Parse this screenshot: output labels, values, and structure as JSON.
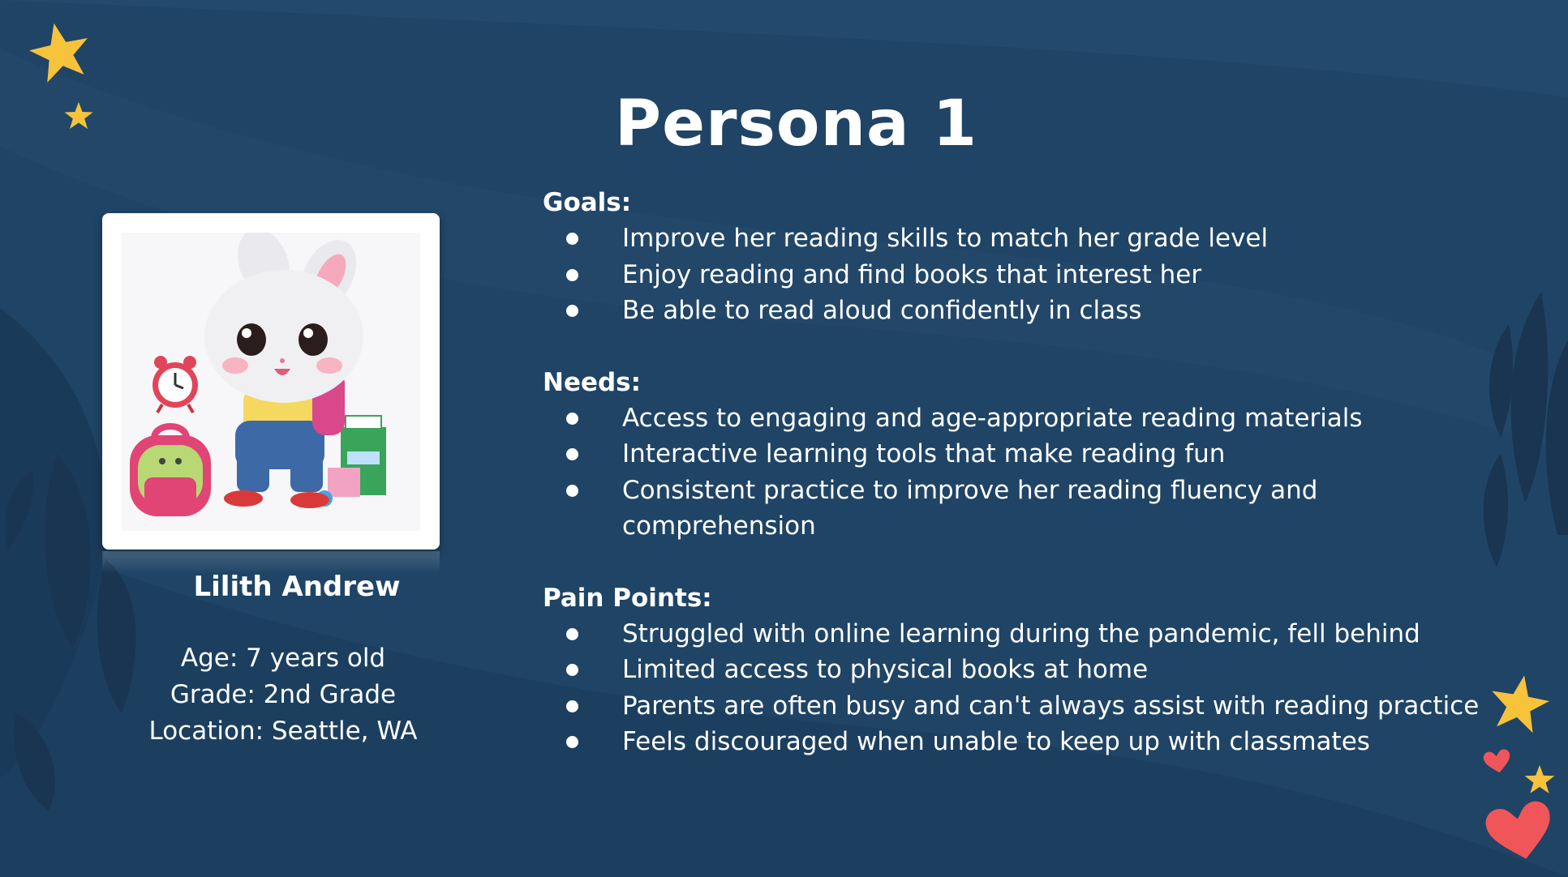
{
  "slide": {
    "title": "Persona 1",
    "colors": {
      "background": "#1f4465",
      "star": "#f7c33b",
      "heart": "#f0555a",
      "text": "#ffffff"
    }
  },
  "persona": {
    "image": "bunny-student-illustration",
    "name": "Lilith Andrew",
    "age": "Age: 7 years old",
    "grade": "Grade: 2nd Grade",
    "location": "Location: Seattle, WA"
  },
  "sections": {
    "goals": {
      "label": "Goals:",
      "items": [
        "Improve her reading skills to match her grade level",
        "Enjoy reading and find books that interest her",
        "Be able to read aloud confidently in class"
      ]
    },
    "needs": {
      "label": "Needs:",
      "items": [
        "Access to engaging and age-appropriate reading materials",
        "Interactive learning tools that make reading fun",
        "Consistent practice to improve her reading fluency and comprehension"
      ]
    },
    "pain_points": {
      "label": "Pain Points:",
      "items": [
        "Struggled with online learning during the pandemic, fell behind",
        "Limited access to physical books at home",
        "Parents are often busy and can't always assist with reading practice",
        "Feels discouraged when unable to keep up with classmates"
      ]
    }
  },
  "decorations": [
    "star-icon",
    "heart-icon",
    "leaf-shape"
  ]
}
